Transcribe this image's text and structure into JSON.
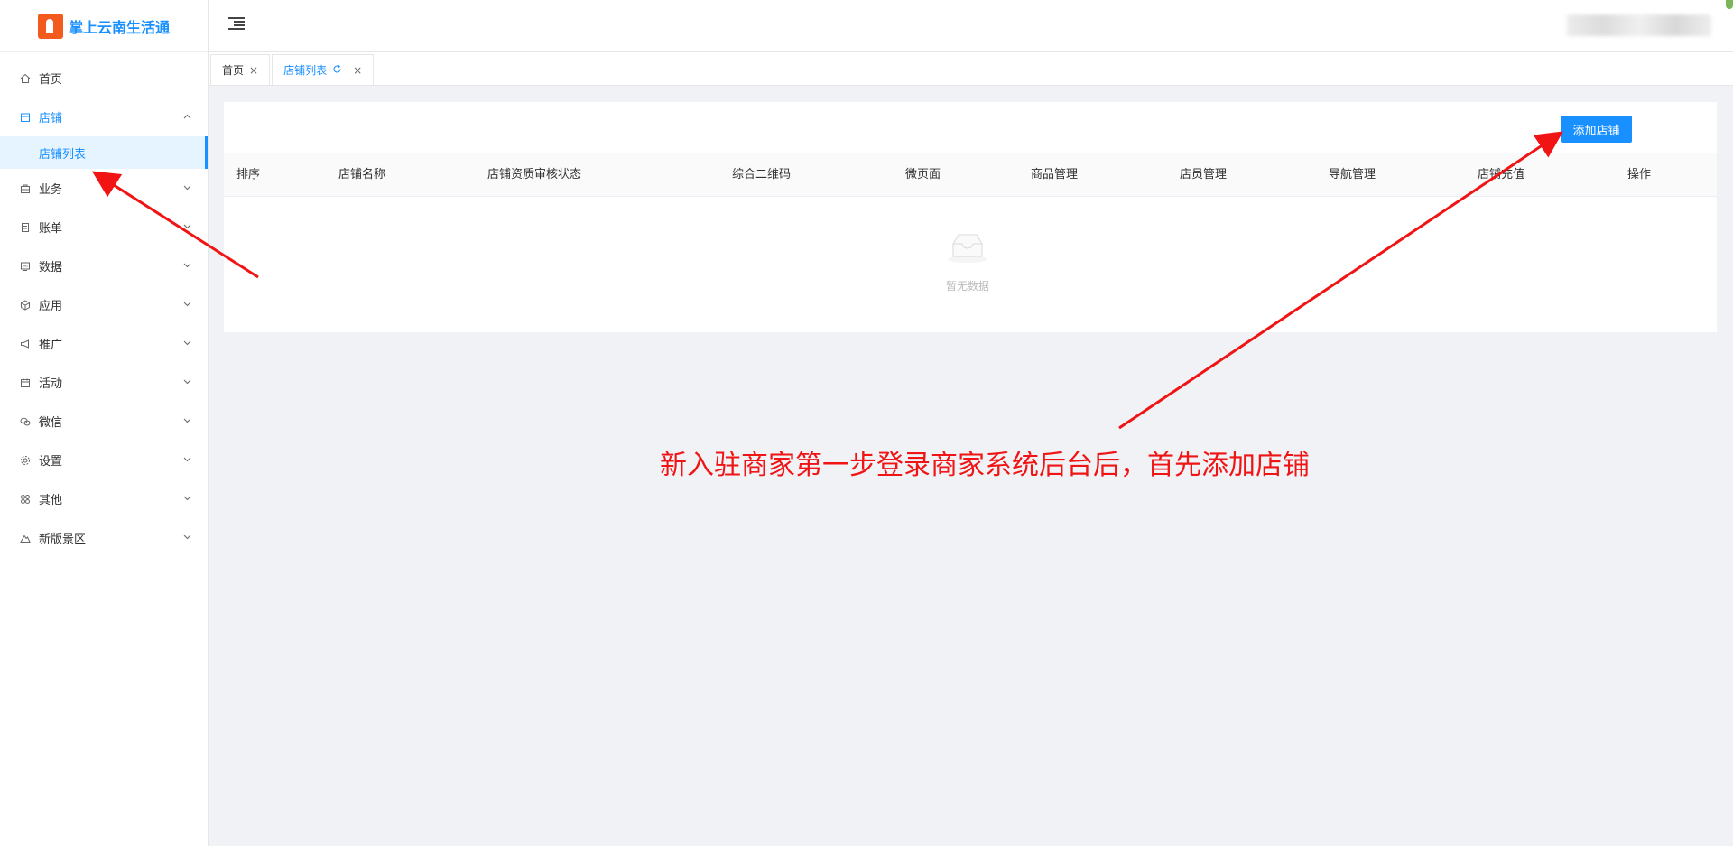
{
  "app": {
    "name": "掌上云南生活通",
    "logo_icon": "elephant-logo-icon"
  },
  "sidebar": {
    "items": [
      {
        "label": "首页",
        "icon": "home-icon"
      },
      {
        "label": "店铺",
        "icon": "shop-icon",
        "expanded": true,
        "children": [
          {
            "label": "店铺列表",
            "active": true
          }
        ]
      },
      {
        "label": "业务",
        "icon": "briefcase-icon"
      },
      {
        "label": "账单",
        "icon": "bill-icon"
      },
      {
        "label": "数据",
        "icon": "data-icon"
      },
      {
        "label": "应用",
        "icon": "cube-icon"
      },
      {
        "label": "推广",
        "icon": "megaphone-icon"
      },
      {
        "label": "活动",
        "icon": "calendar-icon"
      },
      {
        "label": "微信",
        "icon": "wechat-icon"
      },
      {
        "label": "设置",
        "icon": "gear-icon"
      },
      {
        "label": "其他",
        "icon": "grid-icon"
      },
      {
        "label": "新版景区",
        "icon": "mountain-icon"
      }
    ]
  },
  "tabs": [
    {
      "label": "首页",
      "active": false
    },
    {
      "label": "店铺列表",
      "active": true
    }
  ],
  "toolbar": {
    "add_label": "添加店铺"
  },
  "table": {
    "columns": [
      "排序",
      "店铺名称",
      "店铺资质审核状态",
      "综合二维码",
      "微页面",
      "商品管理",
      "店员管理",
      "导航管理",
      "店铺充值",
      "操作"
    ],
    "rows": [],
    "empty_text": "暂无数据"
  },
  "annotation": {
    "text": "新入驻商家第一步登录商家系统后台后，首先添加店铺",
    "color": "#f01414"
  },
  "colors": {
    "accent": "#1890ff",
    "logo": "#f25a1e"
  }
}
